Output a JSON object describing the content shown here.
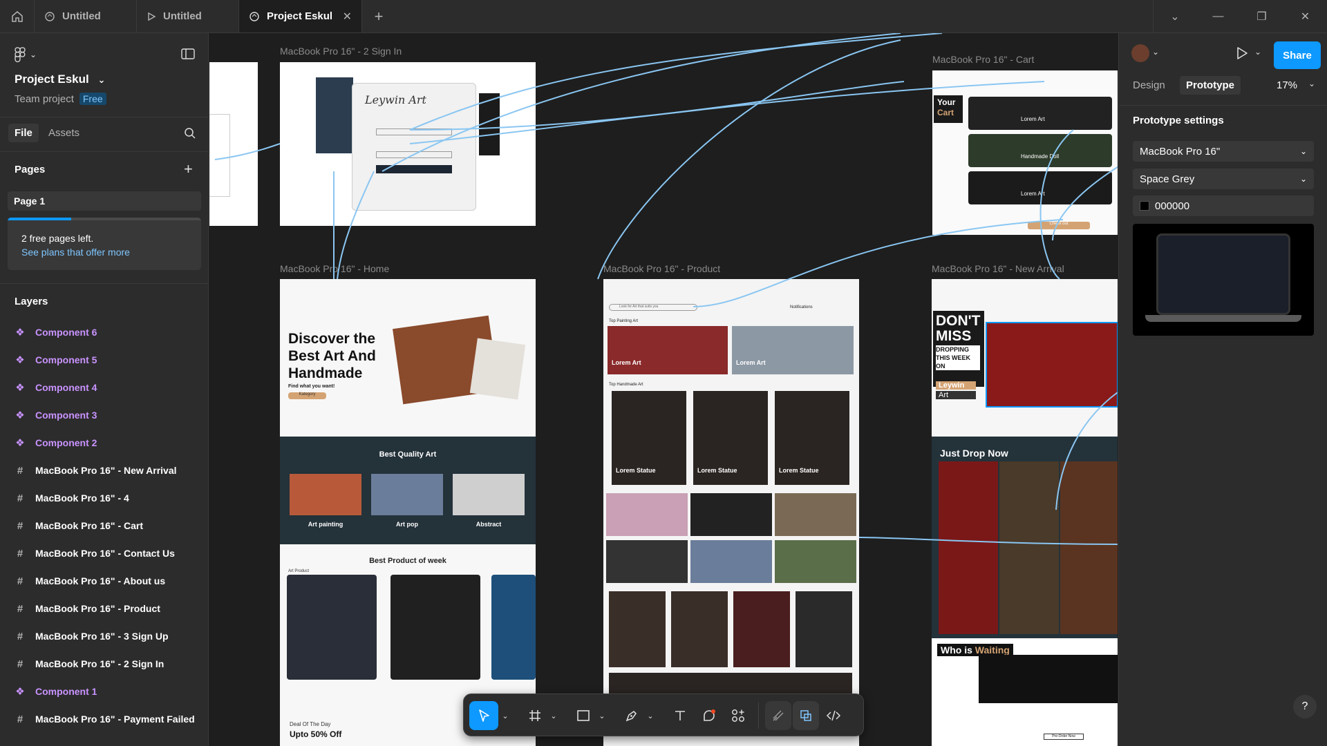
{
  "tabs": [
    {
      "label": "Untitled",
      "icon": "file-icon"
    },
    {
      "label": "Untitled",
      "icon": "play-icon"
    },
    {
      "label": "Project Eskul",
      "icon": "file-icon"
    }
  ],
  "project": {
    "title": "Project Eskul",
    "team": "Team project",
    "plan": "Free"
  },
  "left_tabs": {
    "file": "File",
    "assets": "Assets"
  },
  "pages": {
    "title": "Pages",
    "current": "Page 1",
    "free_msg": "2 free pages left.",
    "free_link": "See plans that offer more",
    "free_used_fraction": 0.33
  },
  "layers": {
    "title": "Layers",
    "items": [
      {
        "label": "Component 6",
        "kind": "component"
      },
      {
        "label": "Component 5",
        "kind": "component"
      },
      {
        "label": "Component 4",
        "kind": "component"
      },
      {
        "label": "Component 3",
        "kind": "component"
      },
      {
        "label": "Component 2",
        "kind": "component"
      },
      {
        "label": "MacBook Pro 16\" - New Arrival",
        "kind": "frame"
      },
      {
        "label": "MacBook Pro 16\" - 4",
        "kind": "frame"
      },
      {
        "label": "MacBook Pro 16\" - Cart",
        "kind": "frame"
      },
      {
        "label": "MacBook Pro 16\" - Contact Us",
        "kind": "frame"
      },
      {
        "label": "MacBook Pro 16\" - About us",
        "kind": "frame"
      },
      {
        "label": "MacBook Pro 16\" - Product",
        "kind": "frame"
      },
      {
        "label": "MacBook Pro 16\" - 3 Sign Up",
        "kind": "frame"
      },
      {
        "label": "MacBook Pro 16\" - 2 Sign In",
        "kind": "frame"
      },
      {
        "label": "Component 1",
        "kind": "component"
      },
      {
        "label": "MacBook Pro 16\" - Payment Failed",
        "kind": "frame"
      }
    ]
  },
  "frames": {
    "signin": "MacBook Pro 16\" - 2 Sign In",
    "cart": "MacBook Pro 16\" - Cart",
    "home": "MacBook Pro 16\" - Home",
    "product": "MacBook Pro 16\" - Product",
    "newarrival": "MacBook Pro 16\" - New Arrival"
  },
  "home": {
    "hero_title": "Discover the Best Art And Handmade",
    "hero_sub": "Find what you want!",
    "category_btn": "Kategory",
    "quality_title": "Best Quality Art",
    "quality_items": [
      "Art painting",
      "Art pop",
      "Abstract"
    ],
    "week_title": "Best Product of week",
    "week_sub": "Art Product",
    "deal_label": "Deal Of The Day",
    "deal_title": "Upto 50% Off"
  },
  "product": {
    "search_placeholder": "Look for Art that suits you",
    "notifications": "Notifications",
    "top_painting": "Top Painting Art",
    "top_handmade": "Top Handmade Art",
    "art_card": "Lorem Art",
    "statue_card": "Lorem Statue"
  },
  "cart": {
    "title_1": "Your",
    "title_2": "Cart",
    "items": [
      "Lorem Art",
      "Handmade Doll",
      "Lorem Art"
    ],
    "checkout": "Check out"
  },
  "newarrival": {
    "dont": "DON'T",
    "miss": "MISS",
    "dropping": "DROPPING THIS WEEK ON",
    "brand": "Leywin",
    "brand2": "Art",
    "just_drop": "Just Drop Now",
    "who": "Who is",
    "waiting": "Waiting",
    "preorder": "Pre-Order Now"
  },
  "right": {
    "design_tab": "Design",
    "prototype_tab": "Prototype",
    "zoom": "17%",
    "settings_title": "Prototype settings",
    "device": "MacBook Pro 16\"",
    "color": "Space Grey",
    "bg_hex": "000000",
    "share": "Share",
    "help": "?"
  }
}
